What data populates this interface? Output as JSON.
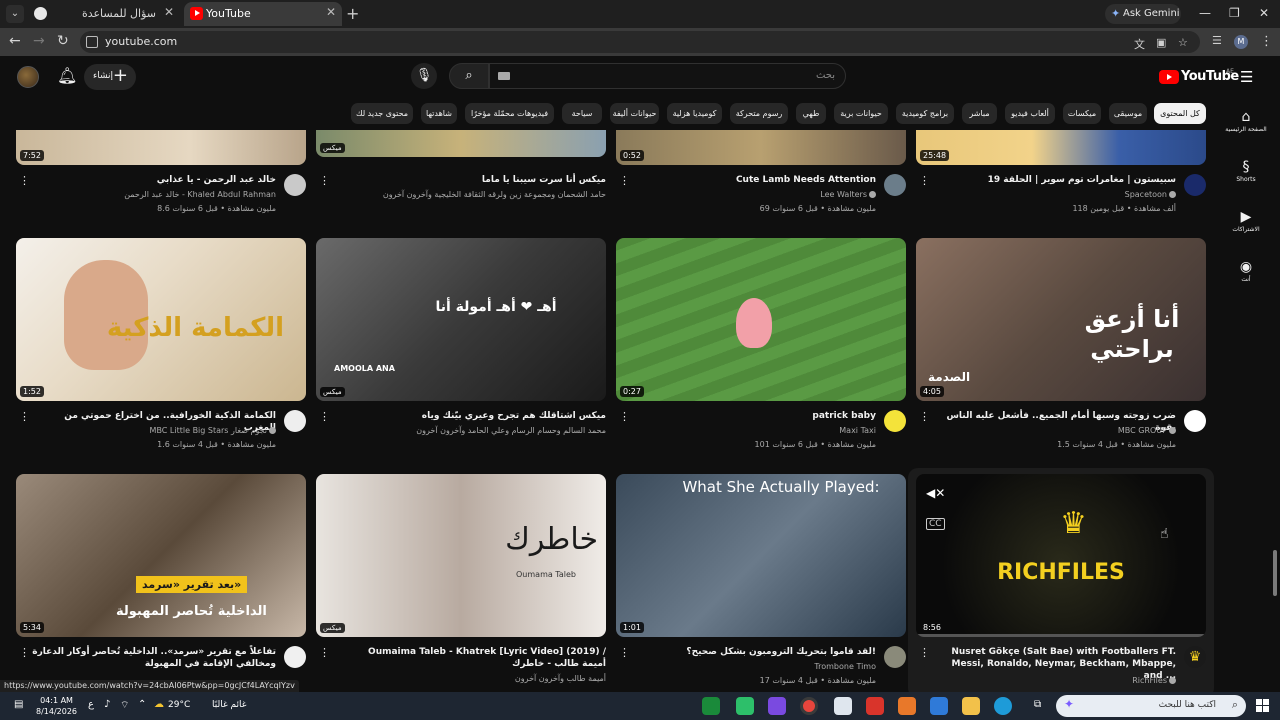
{
  "browser": {
    "tabs": [
      {
        "title": "سؤال للمساعدة",
        "active": false
      },
      {
        "title": "YouTube",
        "active": true
      }
    ],
    "new_tab_label": "+",
    "ask_gemini": "Ask Gemini",
    "url": "youtube.com",
    "profile_initial": "M",
    "status_url": "https://www.youtube.com/watch?v=24cbAI06Ptw&pp=0gcJCf4LAYcqIYzv"
  },
  "youtube": {
    "logo_text": "YouTube",
    "region": "AE",
    "create_label": "إنشاء",
    "search_placeholder": "بحث",
    "chips": [
      {
        "label": "كل المحتوى",
        "selected": true
      },
      {
        "label": "موسيقى"
      },
      {
        "label": "ميكسات"
      },
      {
        "label": "ألعاب فيديو"
      },
      {
        "label": "مباشر"
      },
      {
        "label": "برامج كوميدية"
      },
      {
        "label": "حيوانات برية"
      },
      {
        "label": "طهي"
      },
      {
        "label": "رسوم متحركة"
      },
      {
        "label": "كوميديا هزلية"
      },
      {
        "label": "حيوانات أليفة"
      },
      {
        "label": "سياحة"
      },
      {
        "label": "فيديوهات محمّلة مؤخرًا"
      },
      {
        "label": "شاهدتها"
      },
      {
        "label": "محتوى جديد لك"
      }
    ],
    "guide": [
      {
        "icon": "home-icon",
        "label": "الصفحة الرئيسية"
      },
      {
        "icon": "shorts-icon",
        "label": "Shorts"
      },
      {
        "icon": "subscriptions-icon",
        "label": "الاشتراكات"
      },
      {
        "icon": "you-icon",
        "label": "أنت"
      }
    ],
    "videos": [
      {
        "title": "خالد عبد الرحمن - يا عذابي",
        "channel": "خالد عبد الرحمن - Khaled Abdul Rahman",
        "stats": "8.6 مليون مشاهدة • قبل 6 سنوات",
        "duration": "7:52"
      },
      {
        "title": "ميكس أنا سرت سيبنا يا ماما",
        "channel": "حامد الشحمان ومجموعة زين ولرقه الثقافة الخليجية وآخرون آخرون",
        "stats": "",
        "duration": "ميكس"
      },
      {
        "title": "Cute Lamb Needs Attention",
        "channel": "Lee Walters",
        "stats": "69 مليون مشاهدة • قبل 6 سنوات",
        "duration": "0:52"
      },
      {
        "title": "سبيستون | مغامرات توم سوير | الحلقة 19",
        "channel": "Spacetoon",
        "stats": "118 ألف مشاهدة • قبل يومين",
        "duration": "25:48"
      },
      {
        "title": "الكمامة الذكية الخورافية.. من اختراع حموتي من المغرب",
        "channel": "MBC Little Big Stars نجوم صغار",
        "stats": "1.6 مليون مشاهدة • قبل 4 سنوات",
        "duration": "1:52",
        "overlay": "الكمامة الذكية"
      },
      {
        "title": "ميكس اشتاقلك هم تجرح وعيري بيّنك وياه",
        "channel": "محمد السالم وحسام الرسام وعلي الحامد وآخرون آخرون",
        "stats": "",
        "duration": "ميكس",
        "overlay": "أهـ ❤ أهـ أمولة  أنا",
        "overlay2": "AMOOLA ANA"
      },
      {
        "title": "patrick baby",
        "channel": "Maxi Taxi",
        "stats": "101 مليون مشاهدة • قبل 6 سنوات",
        "duration": "0:27"
      },
      {
        "title": "ضرب زوجته وسبها أمام الجميع.. فأشعل عليه الناس بقوة",
        "channel": "MBC GROUP",
        "stats": "1.5 مليون مشاهدة • قبل 4 سنوات",
        "duration": "4:05",
        "overlay": "أنا أزعق براحتي",
        "overlay2": "الصدمة"
      },
      {
        "title": "تفاعلاً مع تقرير «سرمد».. الداخلية تُحاصر أوكار الدعارة ومخالفي الإقامة في المهبولة",
        "channel": "",
        "stats": "",
        "duration": "5:34",
        "overlay": "بعد تقرير «سرمد»",
        "overlay2": "الداخلية تُحاصر المهبولة"
      },
      {
        "title": "Oumaima Taleb - Khatrek [Lyric Video] (2019) / أميمة طالب - خاطرك",
        "channel": "أميمة طالب وآخرون آخرون",
        "stats": "",
        "duration": "ميكس",
        "overlay": "خاطرك",
        "overlay2": "Oumama Taleb"
      },
      {
        "title": "لقد قاموا بتحريك الترومبون بشكل صحيح؟!",
        "channel": "Trombone Timo",
        "stats": "17 مليون مشاهدة • قبل 4 سنوات",
        "duration": "1:01",
        "overlay": "What She Actually Played:"
      },
      {
        "title": "Nusret Gökçe (Salt Bae) with Footballers FT. Messi, Ronaldo, Neymar, Beckham, Mbappe, and ...",
        "channel": "RichFiles",
        "stats": "",
        "duration": "8:56",
        "overlay": "RICHFILES"
      }
    ]
  },
  "taskbar": {
    "time": "04:1 AM",
    "date": "8/14/2026",
    "lang": "ع",
    "temperature": "29°C",
    "weather": "غائم غالبًا",
    "search_text": "اكتب هنا للبحث"
  }
}
